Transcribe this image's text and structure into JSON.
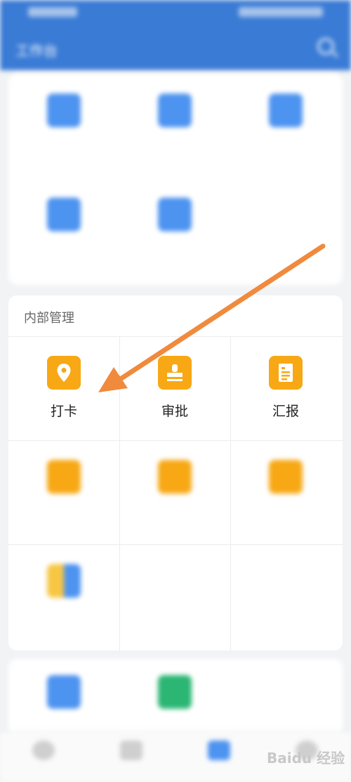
{
  "header": {
    "title": "工作台"
  },
  "section_internal": {
    "title": "内部管理",
    "items": [
      {
        "label": "打卡",
        "icon": "location-pin-icon"
      },
      {
        "label": "审批",
        "icon": "stamp-icon"
      },
      {
        "label": "汇报",
        "icon": "report-document-icon"
      }
    ]
  },
  "watermark": {
    "text": "Baidu 经验"
  },
  "colors": {
    "header": "#3a7bd5",
    "accent_orange": "#f7a814",
    "arrow": "#f08a3c",
    "blue_icon": "#4d93f0"
  }
}
